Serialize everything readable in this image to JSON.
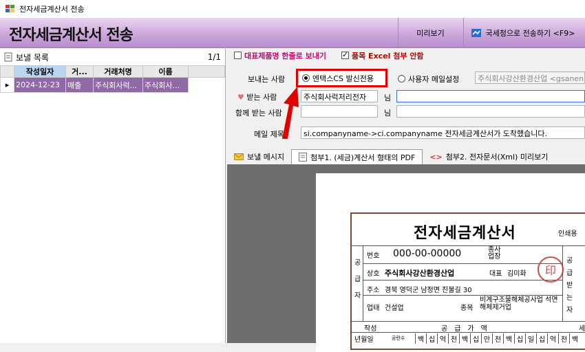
{
  "window": {
    "title": "전자세금계산서 전송"
  },
  "header": {
    "title": "전자세금계산서 전송",
    "preview_label": "미리보기",
    "nts_send_label": "국세청으로 전송하기 <F9>"
  },
  "list": {
    "title": "보낼 목록",
    "page": "1/1",
    "columns": [
      "작성일자",
      "거...",
      "거래처명",
      "이름"
    ],
    "rows": [
      [
        "2024-12-23",
        "매출",
        "주식회사럭...",
        "주식회사..."
      ]
    ]
  },
  "options": {
    "one_line_label": "대표제품명 한줄로 보내기",
    "one_line_checked": false,
    "excel_label": "품목 Excel 첨부 안함",
    "excel_checked": true
  },
  "form": {
    "sender_label": "보내는 사람",
    "sender_option1": "엔택스CS 발신전용",
    "sender_option2": "사용자 메일설정",
    "sender_email": "주식회사강산환경산업 <gsanen",
    "recipient_label": "받는 사람",
    "recipient_name": "주식회사럭저리전자",
    "nim": "님",
    "cc_label": "함께 받는 사람",
    "subject_label": "메일 제목",
    "subject_value": "si.companyname->ci.companyname 전자세금계산서가 도착했습니다."
  },
  "tabs": [
    {
      "label": "보낼 메시지"
    },
    {
      "label": "첨부1. (세금)계산서 형태의 PDF"
    },
    {
      "label": "첨부2. 전자문서(Xml) 미리보기"
    }
  ],
  "invoice": {
    "title": "전자세금계산서",
    "print_label": "인쇄용",
    "supplier_side": "공급자",
    "receiver_side": "공급받는자",
    "reg_no_label": "번호",
    "reg_no": "000-00-00000",
    "branch_label": "종사업장",
    "company_label": "상호",
    "company": "주식회사강산환경산업",
    "ceo_label": "대표",
    "ceo": "김미화",
    "addr_label": "주소",
    "addr": "경북 영덕군 남정면 진불길 30",
    "biz_label": "업태",
    "biz": "건설업",
    "item_label": "종목",
    "item": "비계구조물해체공사업 석면해체제거업",
    "written_label": "작성",
    "supply_label": "공급가액",
    "tax_label": "세",
    "ymd_label": "년월일",
    "blank_label": "공란수",
    "digits": [
      "백",
      "십",
      "억",
      "천",
      "백",
      "십",
      "만",
      "천",
      "백",
      "십",
      "일",
      "십",
      "억",
      "천",
      "백"
    ],
    "seal_char": "印"
  },
  "colors": {
    "header": "#c9a3d9",
    "row_selected": "#8f6aa4",
    "highlight": "#e00000"
  }
}
